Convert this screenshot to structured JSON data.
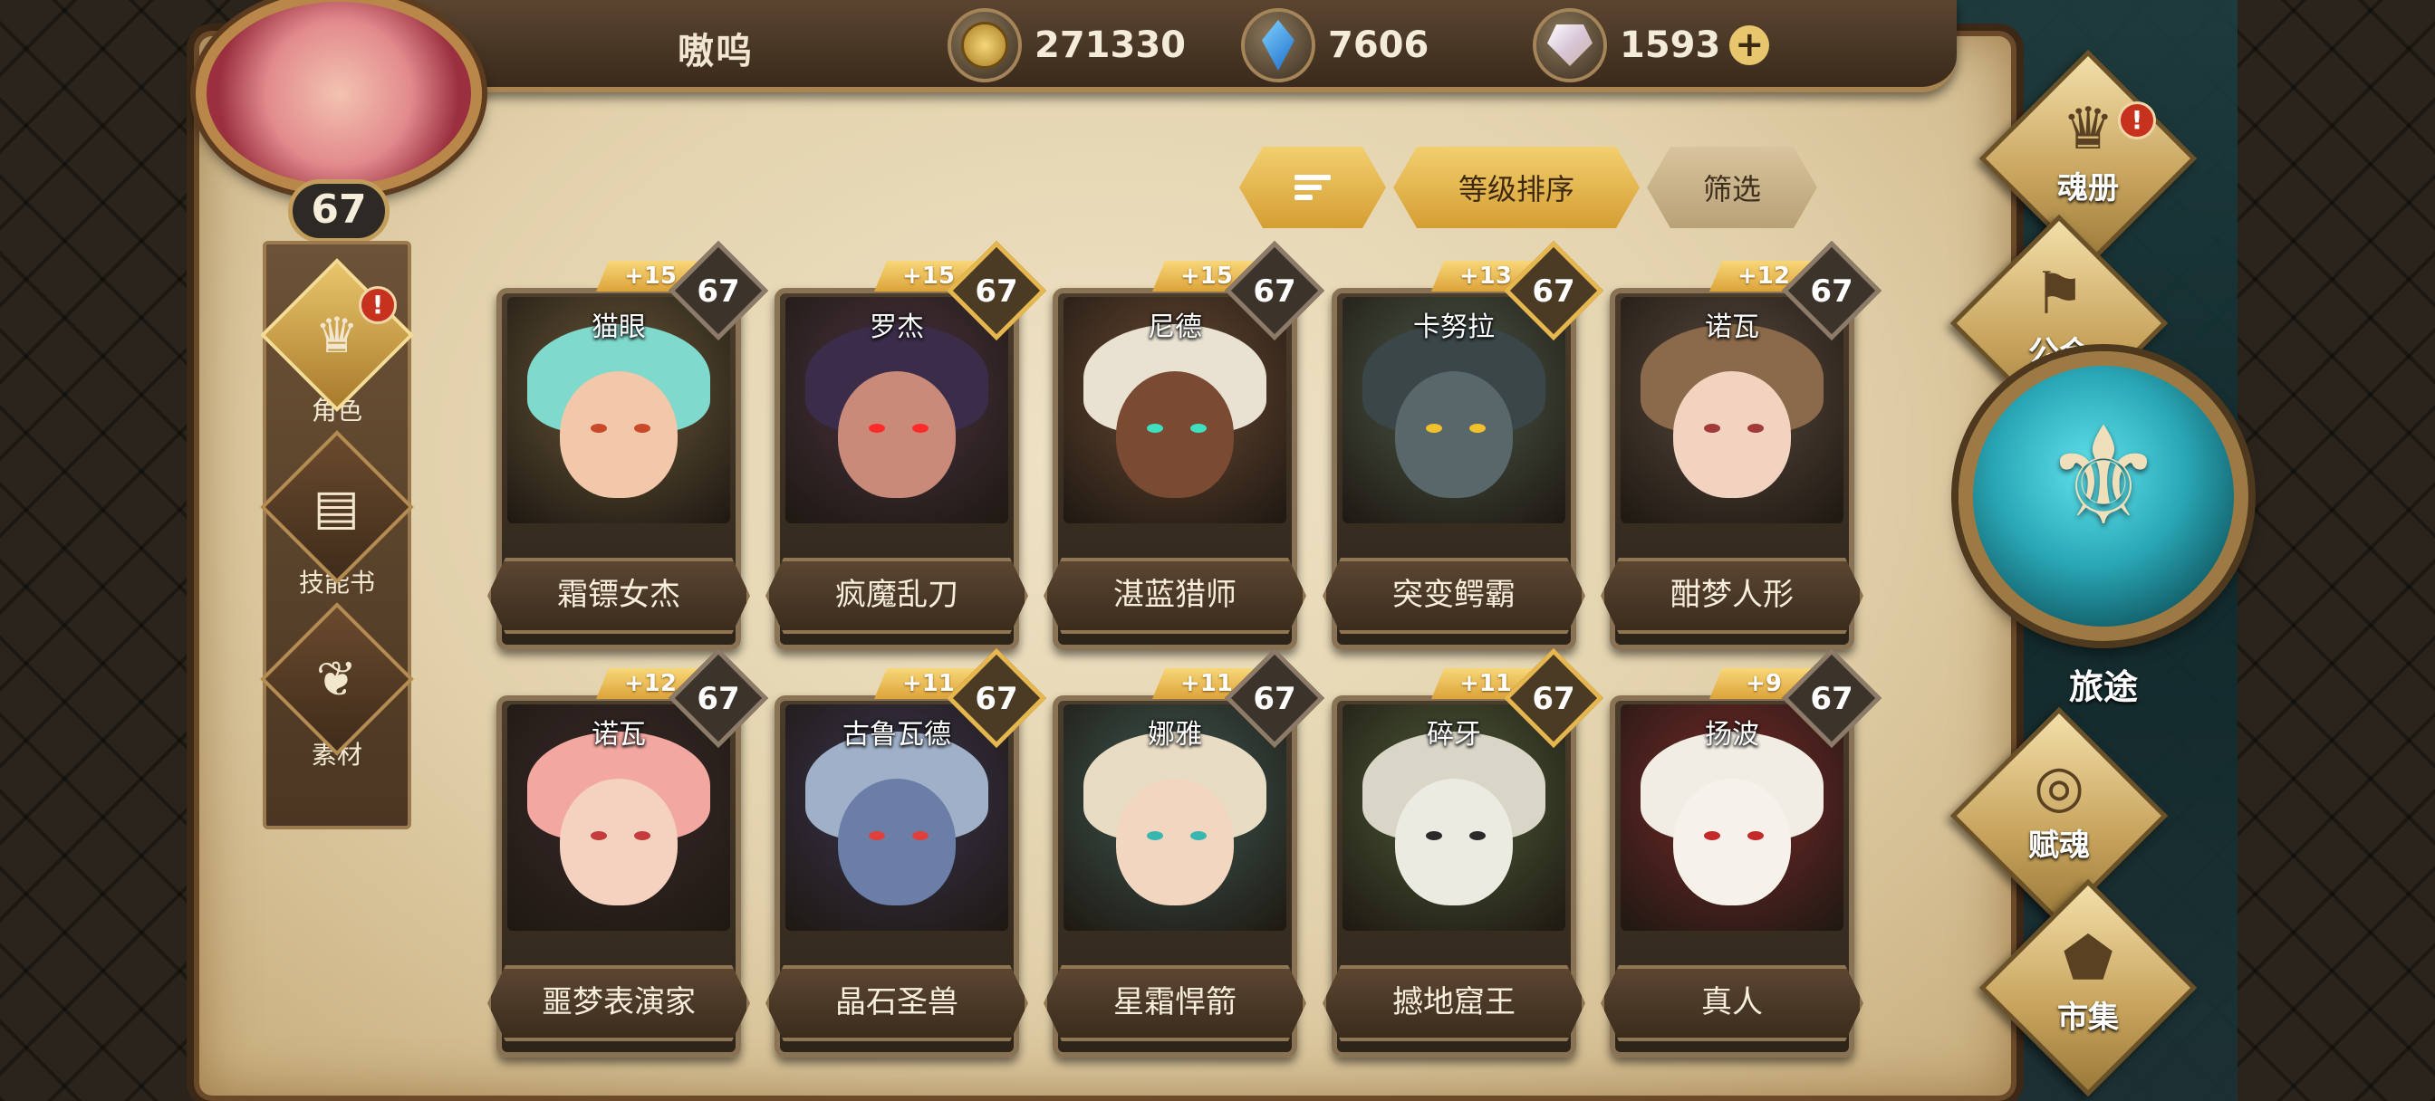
{
  "header": {
    "player_name": "嗷呜",
    "player_level": "67",
    "gold": "271330",
    "crystals": "7606",
    "gems": "1593",
    "add_symbol": "+"
  },
  "left_nav": {
    "items": [
      {
        "label": "角色",
        "icon": "warrior-helmet-icon",
        "alert": "!"
      },
      {
        "label": "技能书",
        "icon": "skill-book-icon"
      },
      {
        "label": "素材",
        "icon": "material-icon"
      }
    ]
  },
  "toolbar": {
    "sort_icon": "sort-lines-icon",
    "sort_by_level": "等级排序",
    "filter": "筛选"
  },
  "heroes": [
    {
      "name": "猫眼",
      "title": "霜镖女杰",
      "bonus": "+15",
      "level": "67",
      "gold_frame": false,
      "hair": "#7fd9cc",
      "skin": "#f3c7a9",
      "bg": "#6b5a3a",
      "eye": "#c94a2a"
    },
    {
      "name": "罗杰",
      "title": "疯魔乱刀",
      "bonus": "+15",
      "level": "67",
      "gold_frame": true,
      "hair": "#3b2d4a",
      "skin": "#c98a7a",
      "bg": "#4a3340",
      "eye": "#ff2a2a"
    },
    {
      "name": "尼德",
      "title": "湛蓝猎师",
      "bonus": "+15",
      "level": "67",
      "gold_frame": false,
      "hair": "#e9e2d3",
      "skin": "#7a4a32",
      "bg": "#6b4a33",
      "eye": "#3fe0c0"
    },
    {
      "name": "卡努拉",
      "title": "突变鳄霸",
      "bonus": "+13",
      "level": "67",
      "gold_frame": true,
      "hair": "#3a4648",
      "skin": "#58676a",
      "bg": "#4d5a4a",
      "eye": "#f2c02a"
    },
    {
      "name": "诺瓦",
      "title": "酣梦人形",
      "bonus": "+12",
      "level": "67",
      "gold_frame": false,
      "hair": "#8a6a4a",
      "skin": "#f1d3bf",
      "bg": "#5a4a3e",
      "eye": "#a33a3a"
    },
    {
      "name": "诺瓦",
      "title": "噩梦表演家",
      "bonus": "+12",
      "level": "67",
      "gold_frame": false,
      "hair": "#f2a8a0",
      "skin": "#f4d2bf",
      "bg": "#3a2a2a",
      "eye": "#c43c3c"
    },
    {
      "name": "古鲁瓦德",
      "title": "晶石圣兽",
      "bonus": "+11",
      "level": "67",
      "gold_frame": true,
      "hair": "#9fb0c8",
      "skin": "#6a7ea8",
      "bg": "#3a3550",
      "eye": "#e0403a"
    },
    {
      "name": "娜雅",
      "title": "星霜悍箭",
      "bonus": "+11",
      "level": "67",
      "gold_frame": false,
      "hair": "#e8dcc4",
      "skin": "#f3d6bf",
      "bg": "#3e5a52",
      "eye": "#3ab6b0"
    },
    {
      "name": "碎牙",
      "title": "撼地窟王",
      "bonus": "+11",
      "level": "67",
      "gold_frame": true,
      "hair": "#d9d6c8",
      "skin": "#ecebe2",
      "bg": "#4f5e3a",
      "eye": "#2a2a2a"
    },
    {
      "name": "扬波",
      "title": "真人",
      "bonus": "+9",
      "level": "67",
      "gold_frame": false,
      "hair": "#f1ece4",
      "skin": "#f6f1ea",
      "bg": "#7a2a2a",
      "eye": "#c42a2a"
    }
  ],
  "right_nav": {
    "soul_book": "魂册",
    "guild": "公会",
    "journey": "旅途",
    "empower": "赋魂",
    "market": "市集",
    "alert": "!"
  }
}
